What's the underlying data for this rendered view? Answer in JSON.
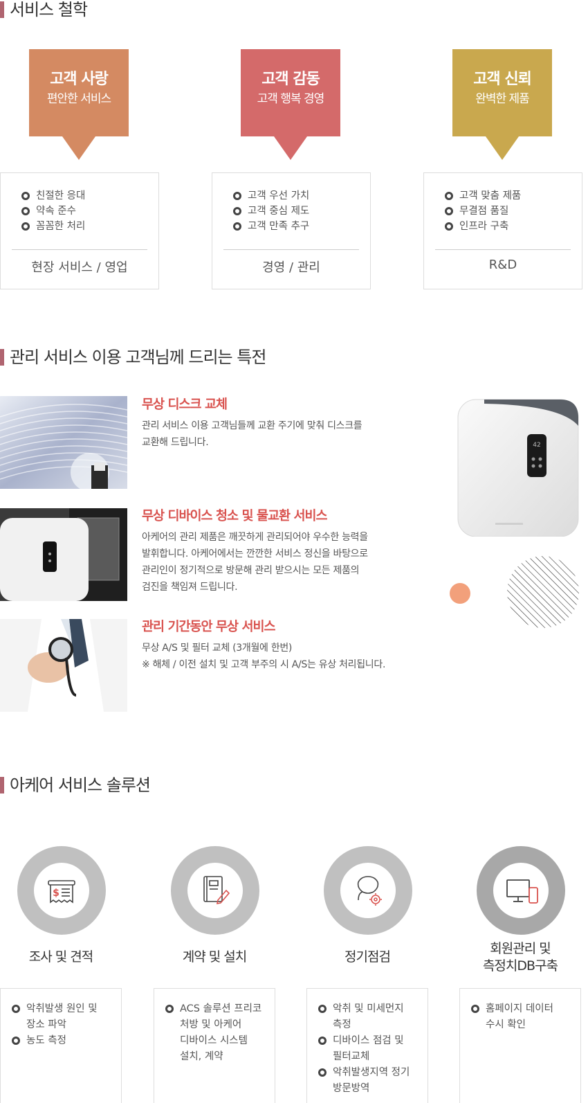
{
  "philosophy": {
    "title": "서비스 철학",
    "columns": [
      {
        "heading": "고객 사랑",
        "subheading": "편안한 서비스",
        "color": "#d48a62",
        "items": [
          "친절한 응대",
          "약속 준수",
          "꼼꼼한 처리"
        ],
        "footer": "현장 서비스 / 영업"
      },
      {
        "heading": "고객 감동",
        "subheading": "고객 행복 경영",
        "color": "#d46a6a",
        "items": [
          "고객 우선 가치",
          "고객 중심 제도",
          "고객 만족 추구"
        ],
        "footer": "경영 / 관리"
      },
      {
        "heading": "고객 신뢰",
        "subheading": "완벽한 제품",
        "color": "#c9a84e",
        "items": [
          "고객 맞춤 제품",
          "무결점 품질",
          "인프라 구축"
        ],
        "footer": "R&D"
      }
    ]
  },
  "benefits": {
    "title": "관리 서비스 이용 고객님께 드리는 특전",
    "items": [
      {
        "title": "무상 디스크 교체",
        "lines": [
          "관리 서비스 이용 고객님들께 교환 주기에 맞춰 디스크를",
          "교환해 드립니다."
        ]
      },
      {
        "title": "무상 디바이스 청소 및 물교환 서비스",
        "lines": [
          "아케어의 관리 제품은 깨끗하게 관리되어야 우수한 능력을",
          "발휘합니다. 아케어에서는 깐깐한 서비스 정신을 바탕으로",
          "관리인이 정기적으로 방문해 관리 받으시는 모든 제품의",
          "검진을 책임져 드립니다."
        ]
      },
      {
        "title": "관리 기간동안 무상 서비스",
        "lines": [
          "무상 A/S 및 필터 교체 (3개월에 한번)",
          "※ 해체 / 이전 설치 및 고객 부주의 시 A/S는 유상 처리됩니다."
        ]
      }
    ]
  },
  "solutions": {
    "title": "아케어 서비스 솔루션",
    "columns": [
      {
        "name_lines": [
          "조사 및 견적"
        ],
        "icon": "receipt-icon",
        "items": [
          [
            "악취발생 원인 및",
            "장소 파악"
          ],
          [
            "농도 측정"
          ]
        ]
      },
      {
        "name_lines": [
          "계약 및 설치"
        ],
        "icon": "contract-icon",
        "items": [
          [
            "ACS 솔루션 프리코",
            "처방 및 아케어",
            "디바이스 시스템",
            "설치, 계약"
          ]
        ]
      },
      {
        "name_lines": [
          "정기점검"
        ],
        "icon": "user-gear-icon",
        "items": [
          [
            "악취 및 미세먼지",
            "측정"
          ],
          [
            "디바이스 점검 및",
            "필터교체"
          ],
          [
            "악취발생지역 정기",
            "방문방역"
          ]
        ]
      },
      {
        "name_lines": [
          "회원관리 및",
          "측정치DB구축"
        ],
        "icon": "monitor-mobile-icon",
        "items": [
          [
            "홈페이지 데이터",
            "수시 확인"
          ]
        ]
      }
    ]
  },
  "colors": {
    "accent_red": "#d9534f",
    "title_bar": "#b06570",
    "orange_dot": "#f2a07b"
  }
}
